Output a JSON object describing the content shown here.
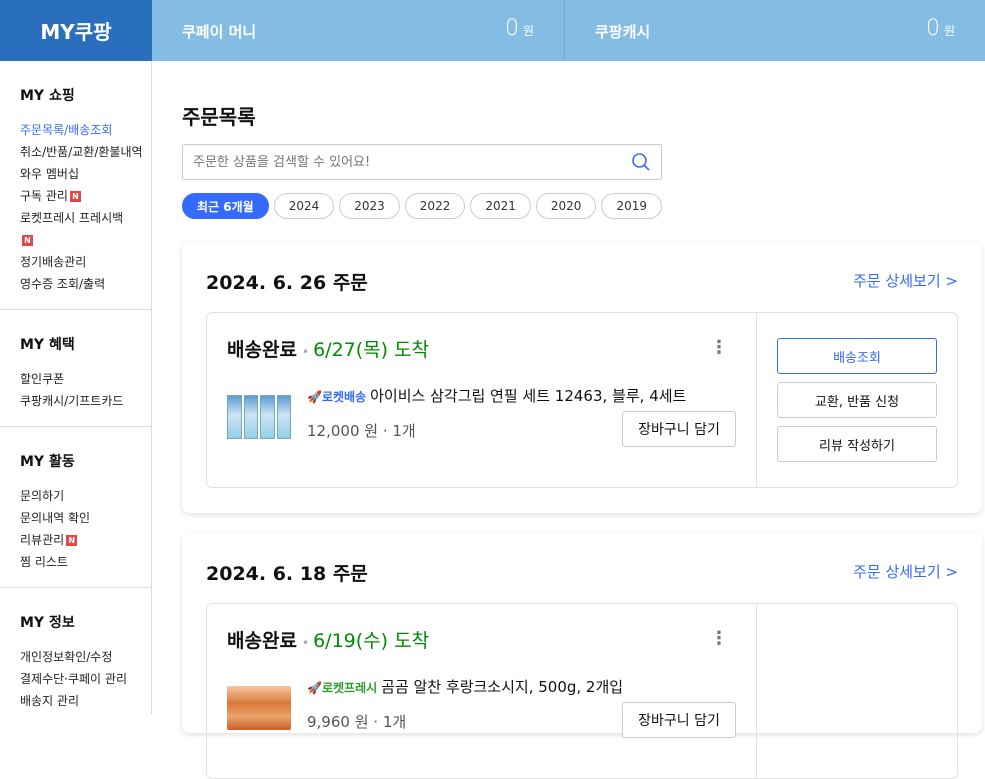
{
  "header": {
    "brand": "MY쿠팡",
    "coupay_label": "쿠페이 머니",
    "coupay_amount": "0",
    "coupay_unit": "원",
    "cash_label": "쿠팡캐시",
    "cash_amount": "0",
    "cash_unit": "원"
  },
  "sidebar": {
    "sections": [
      {
        "title": "MY 쇼핑",
        "items": [
          "주문목록/배송조회",
          "취소/반품/교환/환불내역",
          "와우 멤버십",
          "구독 관리",
          "로켓프레시 프레시백",
          "정기배송관리",
          "영수증 조회/출력"
        ]
      },
      {
        "title": "MY 혜택",
        "items": [
          "할인쿠폰",
          "쿠팡캐시/기프트카드"
        ]
      },
      {
        "title": "MY 활동",
        "items": [
          "문의하기",
          "문의내역 확인",
          "리뷰관리",
          "찜 리스트"
        ]
      },
      {
        "title": "MY 정보",
        "items": [
          "개인정보확인/수정",
          "결제수단·쿠페이 관리",
          "배송지 관리"
        ]
      }
    ],
    "badge": "N"
  },
  "main": {
    "title": "주문목록",
    "search_placeholder": "주문한 상품을 검색할 수 있어요!",
    "years": [
      "최근 6개월",
      "2024",
      "2023",
      "2022",
      "2021",
      "2020",
      "2019"
    ]
  },
  "orders": [
    {
      "date": "2024. 6. 26 주문",
      "detail_link": "주문 상세보기 >",
      "status": "배송완료",
      "arrival": "6/27(목) 도착",
      "badge": "로켓배송",
      "product": "아이비스 삼각그립 연필 세트 12463, 블루, 4세트",
      "price": "12,000 원 · 1개",
      "cart": "장바구니 담기",
      "actions": [
        "배송조회",
        "교환, 반품 신청",
        "리뷰 작성하기"
      ]
    },
    {
      "date": "2024. 6. 18 주문",
      "detail_link": "주문 상세보기 >",
      "status": "배송완료",
      "arrival": "6/19(수) 도착",
      "badge": "로켓프레시",
      "product": "곰곰 알찬 후랑크소시지, 500g, 2개입",
      "price": "9,960 원 · 1개",
      "cart": "장바구니 담기"
    }
  ],
  "colors": {
    "brand": "#2a6fbe",
    "accent": "#346aff",
    "arrival": "#008c00",
    "header_bar": "#84bde3"
  }
}
